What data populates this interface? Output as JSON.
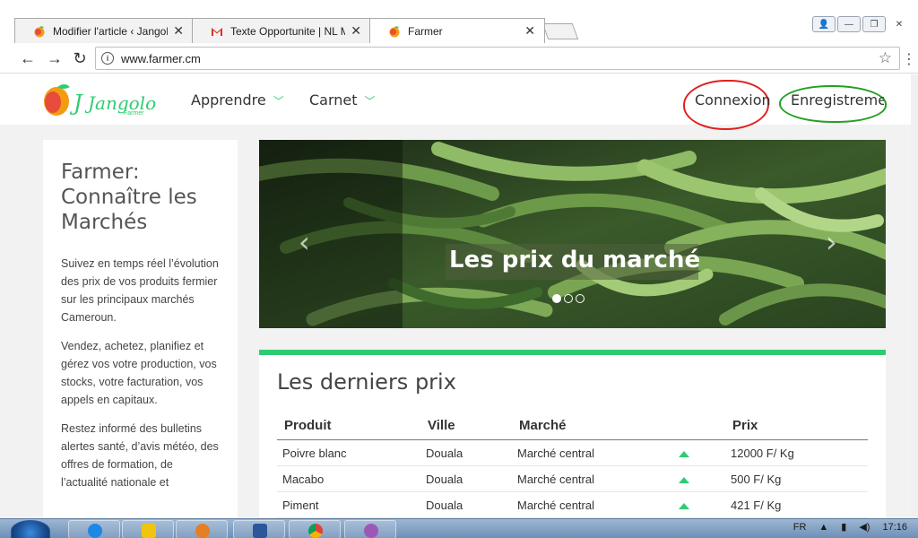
{
  "browser": {
    "tabs": [
      {
        "title": "Modifier l'article ‹ Jangol",
        "favicon": "jangolo-favicon",
        "active": false
      },
      {
        "title": "Texte Opportunite | NL M",
        "favicon": "gmail-favicon",
        "active": false
      },
      {
        "title": "Farmer",
        "favicon": "jangolo-favicon",
        "active": true
      }
    ],
    "url": "www.farmer.cm"
  },
  "site": {
    "logo_text": "Jangolo",
    "logo_sub": "Farmer",
    "nav": [
      {
        "label": "Apprendre"
      },
      {
        "label": "Carnet"
      }
    ],
    "login_label": "Connexion",
    "register_label": "Enregistremen"
  },
  "sidebar": {
    "title": "Farmer: Connaître les Marchés",
    "paragraphs": [
      "Suivez en temps réel l’évolution des prix de vos produits fermier sur les principaux marchés Cameroun.",
      "Vendez, achetez, planifiez et gérez vos votre production, vos stocks, votre facturation, vos appels en capitaux.",
      "Restez informé des bulletins alertes santé, d’avis météo, des offres de formation, de l’actualité nationale et"
    ]
  },
  "carousel": {
    "caption": "Les prix du marché",
    "slide_count": 3,
    "active_slide": 1
  },
  "prices": {
    "heading": "Les derniers prix",
    "columns": [
      "Produit",
      "Ville",
      "Marché",
      "",
      "Prix"
    ],
    "rows": [
      {
        "produit": "Poivre blanc",
        "ville": "Douala",
        "marche": "Marché central",
        "trend": "up",
        "prix": "12000 F/ Kg"
      },
      {
        "produit": "Macabo",
        "ville": "Douala",
        "marche": "Marché central",
        "trend": "up",
        "prix": "500 F/ Kg"
      },
      {
        "produit": "Piment",
        "ville": "Douala",
        "marche": "Marché central",
        "trend": "up",
        "prix": "421 F/ Kg"
      }
    ]
  },
  "taskbar": {
    "lang": "FR",
    "time": "17:16"
  },
  "colors": {
    "brand_green": "#2ecc71",
    "annotation_red": "#e02020",
    "annotation_green": "#22a022"
  }
}
